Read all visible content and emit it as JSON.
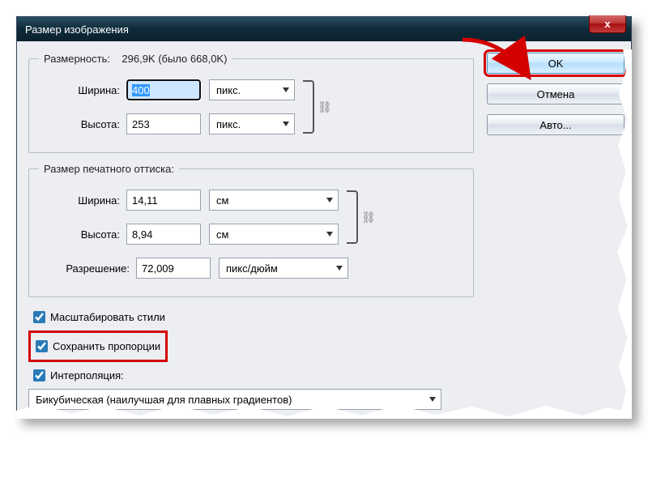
{
  "window": {
    "title": "Размер изображения"
  },
  "pixel_dims": {
    "legend_prefix": "Размерность:",
    "legend_value": "296,9K (было 668,0K)",
    "width_label": "Ширина:",
    "width_value": "400",
    "width_unit": "пикс.",
    "height_label": "Высота:",
    "height_value": "253",
    "height_unit": "пикс."
  },
  "print_dims": {
    "legend": "Размер печатного оттиска:",
    "width_label": "Ширина:",
    "width_value": "14,11",
    "width_unit": "см",
    "height_label": "Высота:",
    "height_value": "8,94",
    "height_unit": "см",
    "res_label": "Разрешение:",
    "res_value": "72,009",
    "res_unit": "пикс/дюйм"
  },
  "checks": {
    "scale_styles": "Масштабировать стили",
    "constrain": "Сохранить пропорции",
    "interpolation": "Интерполяция:"
  },
  "interp_method": "Бикубическая (наилучшая для плавных градиентов)",
  "buttons": {
    "ok": "OK",
    "cancel": "Отмена",
    "auto": "Авто..."
  },
  "icons": {
    "close": "x",
    "chain": "⛓"
  }
}
